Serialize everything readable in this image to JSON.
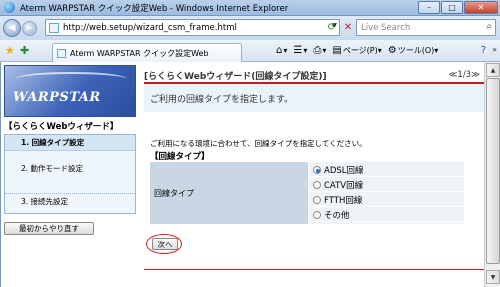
{
  "window": {
    "title": "Aterm WARPSTAR クイック設定Web - Windows Internet Explorer"
  },
  "browser": {
    "url": "http://web.setup/wizard_csm_frame.html",
    "search_placeholder": "Live Search",
    "tab_label": "Aterm WARPSTAR クイック設定Web",
    "tools": [
      {
        "icon": "home-icon",
        "label": ""
      },
      {
        "icon": "feeds-icon",
        "label": ""
      },
      {
        "icon": "print-icon",
        "label": ""
      },
      {
        "icon": "page-icon",
        "label": "ページ(P)"
      },
      {
        "icon": "tools-icon",
        "label": "ツール(O)"
      }
    ]
  },
  "sidebar": {
    "logo_text": "WARPSTAR",
    "heading": "【らくらくWebウィザード】",
    "items": [
      {
        "label": "1. 回線タイプ設定",
        "selected": true
      },
      {
        "label": "2. 動作モード設定",
        "selected": false
      },
      {
        "label": "3. 接続先設定",
        "selected": false
      }
    ],
    "restart_label": "最初からやり直す"
  },
  "main": {
    "header_title": "[らくらくWebウィザード(回線タイプ設定)]",
    "page_indicator": "≪1/3≫",
    "instruction": "ご利用の回線タイプを指定します。",
    "description": "ご利用になる環境に合わせて、回線タイプを指定してください。",
    "section_title": "【回線タイプ】",
    "field_label": "回線タイプ",
    "options": [
      {
        "label": "ADSL回線",
        "checked": true
      },
      {
        "label": "CATV回線",
        "checked": false
      },
      {
        "label": "FTTH回線",
        "checked": false
      },
      {
        "label": "その他",
        "checked": false
      }
    ],
    "next_label": "次へ"
  }
}
